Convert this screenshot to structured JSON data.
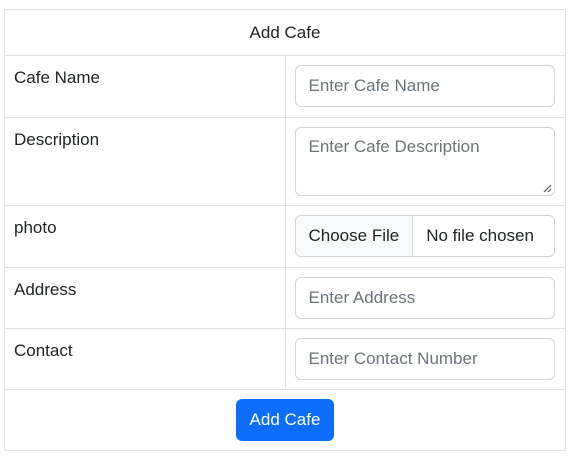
{
  "form": {
    "title": "Add Cafe",
    "fields": {
      "name": {
        "label": "Cafe Name",
        "placeholder": "Enter Cafe Name"
      },
      "description": {
        "label": "Description",
        "placeholder": "Enter Cafe Description"
      },
      "photo": {
        "label": "photo",
        "button_label": "Choose File",
        "status": "No file chosen"
      },
      "address": {
        "label": "Address",
        "placeholder": "Enter Address"
      },
      "contact": {
        "label": "Contact",
        "placeholder": "Enter Contact Number"
      }
    },
    "submit_label": "Add Cafe"
  },
  "colors": {
    "primary": "#0d6efd",
    "border": "#dee2e6",
    "input_border": "#ced4da",
    "placeholder": "#6c757d"
  }
}
